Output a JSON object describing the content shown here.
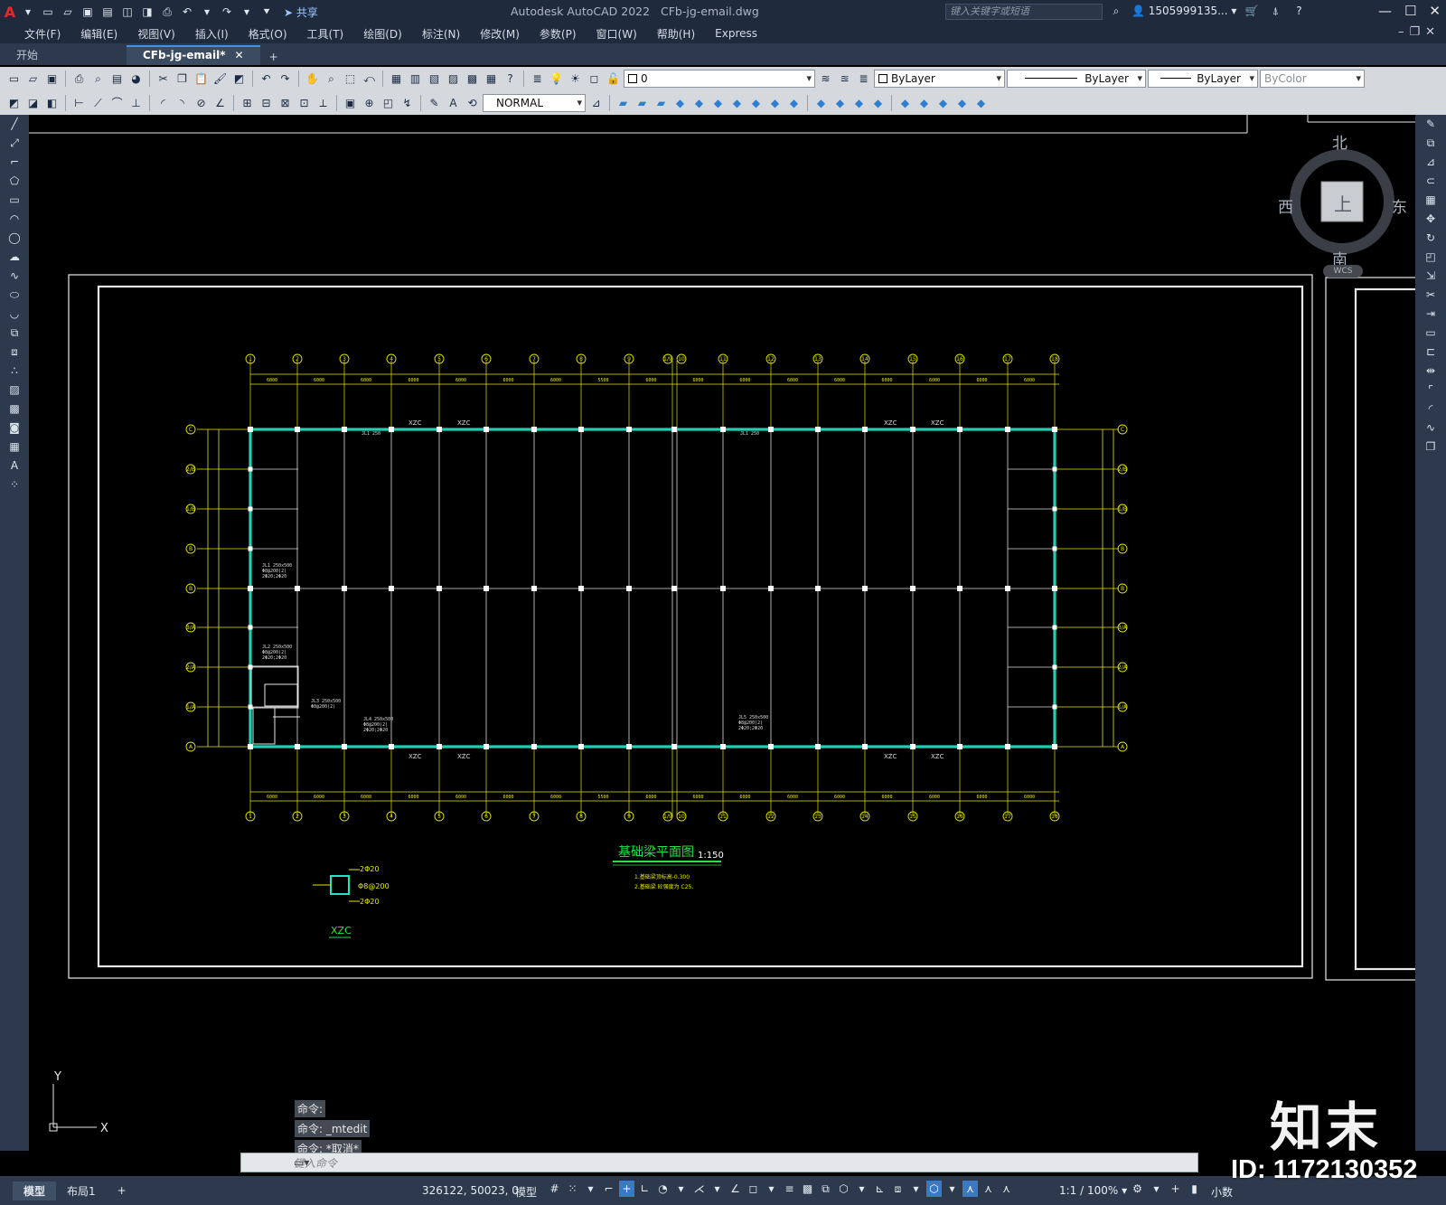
{
  "titlebar": {
    "app_title": "Autodesk AutoCAD 2022",
    "file_name": "CFb-jg-email.dwg",
    "share_label": "共享",
    "search_placeholder": "键入关键字或短语",
    "user": "1505999135..."
  },
  "menu": [
    "文件(F)",
    "编辑(E)",
    "视图(V)",
    "插入(I)",
    "格式(O)",
    "工具(T)",
    "绘图(D)",
    "标注(N)",
    "修改(M)",
    "参数(P)",
    "窗口(W)",
    "帮助(H)",
    "Express"
  ],
  "tabs": {
    "start": "开始",
    "active": "CFb-jg-email*",
    "add": "+"
  },
  "toolbar": {
    "layer_value": "0",
    "color_value": "ByLayer",
    "linetype_value": "ByLayer",
    "lineweight_value": "ByLayer",
    "plotstyle_value": "ByColor",
    "dimstyle_value": "NORMAL"
  },
  "viewcube": {
    "north": "北",
    "south": "南",
    "east": "东",
    "west": "西",
    "face": "上",
    "wcs": "WCS"
  },
  "drawing": {
    "title": "基础梁平面图",
    "scale": "1:150",
    "note1": "1.基础梁顶标高-0.300",
    "note2": "2.基础梁 砼强度为 C25.",
    "detail_title": "XZC",
    "detail_rebar1": "2Φ20",
    "detail_rebar2": "Φ8@200",
    "detail_rebar3": "2Φ20",
    "column_label": "XZC",
    "col_grid_labels": [
      "1",
      "2",
      "3",
      "4",
      "5",
      "6",
      "7",
      "8",
      "9",
      "1/9",
      "10",
      "11",
      "12",
      "13",
      "14",
      "15",
      "16",
      "17",
      "18"
    ],
    "row_grid_labels": [
      "C",
      "2/B",
      "1/B",
      "B",
      "3/A",
      "2/A",
      "1/A",
      "A"
    ],
    "span_dims": [
      "6000",
      "6000",
      "6000",
      "6000",
      "6000",
      "6000",
      "6000",
      "5500",
      "6000",
      "6000",
      "6000",
      "6000",
      "6000",
      "6000",
      "6000",
      "6000",
      "6000"
    ]
  },
  "ucs": {
    "x": "X",
    "y": "Y"
  },
  "command": {
    "history": [
      "命令:",
      "命令: _mtedit",
      "命令: *取消*"
    ],
    "placeholder": "键入命令"
  },
  "status": {
    "model_tab": "模型",
    "layout_tab": "布局1",
    "coords": "326122, 50023, 0",
    "mode": "模型",
    "scale": "1:1 / 100%",
    "units": "小数"
  },
  "watermark": {
    "brand": "知末",
    "id": "ID: 1172130352"
  }
}
